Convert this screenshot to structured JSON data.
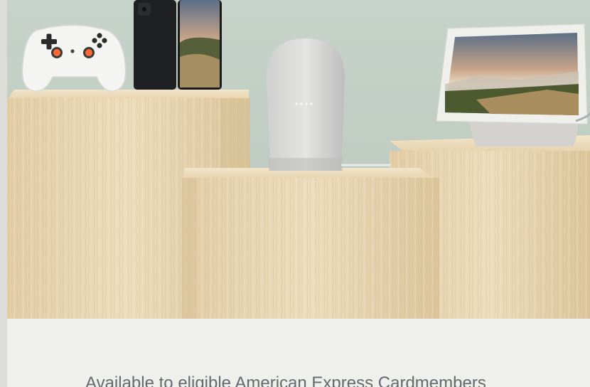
{
  "hero": {
    "products": [
      {
        "name": "Stadia Controller",
        "icon": "game-controller-icon"
      },
      {
        "name": "Pixel 5",
        "icon": "smartphone-icon"
      },
      {
        "name": "Nest Audio",
        "icon": "smart-speaker-icon"
      },
      {
        "name": "Nest Hub",
        "icon": "smart-display-icon"
      }
    ],
    "colors": {
      "background": "#c3cfc6",
      "wood": "#e9d6b2",
      "caption_text": "#666a6f",
      "caption_bg": "#efefeb"
    }
  },
  "caption": {
    "text": "Available to eligible American Express Cardmembers"
  }
}
